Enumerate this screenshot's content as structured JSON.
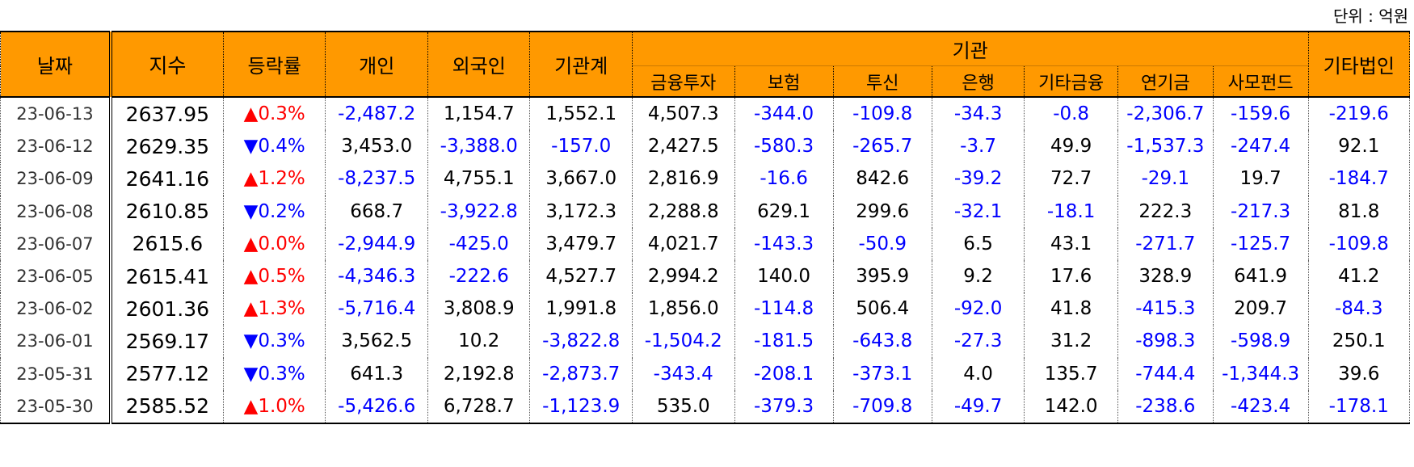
{
  "unit_label": "단위 : 억원",
  "headers": {
    "date": "날짜",
    "index": "지수",
    "change": "등락률",
    "individual": "개인",
    "foreign": "외국인",
    "inst_total": "기관계",
    "institution": "기관",
    "sub": [
      "금융투자",
      "보험",
      "투신",
      "은행",
      "기타금융",
      "연기금",
      "사모펀드"
    ],
    "other_corp": "기타법인"
  },
  "up_glyph": "▲",
  "down_glyph": "▼",
  "rows": [
    {
      "date": "23-06-13",
      "index": "2637.95",
      "dir": "up",
      "rate": "0.3%",
      "vals": [
        "-2,487.2",
        "1,154.7",
        "1,552.1",
        "4,507.3",
        "-344.0",
        "-109.8",
        "-34.3",
        "-0.8",
        "-2,306.7",
        "-159.6",
        "-219.6"
      ]
    },
    {
      "date": "23-06-12",
      "index": "2629.35",
      "dir": "down",
      "rate": "0.4%",
      "vals": [
        "3,453.0",
        "-3,388.0",
        "-157.0",
        "2,427.5",
        "-580.3",
        "-265.7",
        "-3.7",
        "49.9",
        "-1,537.3",
        "-247.4",
        "92.1"
      ]
    },
    {
      "date": "23-06-09",
      "index": "2641.16",
      "dir": "up",
      "rate": "1.2%",
      "vals": [
        "-8,237.5",
        "4,755.1",
        "3,667.0",
        "2,816.9",
        "-16.6",
        "842.6",
        "-39.2",
        "72.7",
        "-29.1",
        "19.7",
        "-184.7"
      ]
    },
    {
      "date": "23-06-08",
      "index": "2610.85",
      "dir": "down",
      "rate": "0.2%",
      "vals": [
        "668.7",
        "-3,922.8",
        "3,172.3",
        "2,288.8",
        "629.1",
        "299.6",
        "-32.1",
        "-18.1",
        "222.3",
        "-217.3",
        "81.8"
      ]
    },
    {
      "date": "23-06-07",
      "index": "2615.6",
      "dir": "up",
      "rate": "0.0%",
      "vals": [
        "-2,944.9",
        "-425.0",
        "3,479.7",
        "4,021.7",
        "-143.3",
        "-50.9",
        "6.5",
        "43.1",
        "-271.7",
        "-125.7",
        "-109.8"
      ]
    },
    {
      "date": "23-06-05",
      "index": "2615.41",
      "dir": "up",
      "rate": "0.5%",
      "vals": [
        "-4,346.3",
        "-222.6",
        "4,527.7",
        "2,994.2",
        "140.0",
        "395.9",
        "9.2",
        "17.6",
        "328.9",
        "641.9",
        "41.2"
      ]
    },
    {
      "date": "23-06-02",
      "index": "2601.36",
      "dir": "up",
      "rate": "1.3%",
      "vals": [
        "-5,716.4",
        "3,808.9",
        "1,991.8",
        "1,856.0",
        "-114.8",
        "506.4",
        "-92.0",
        "41.8",
        "-415.3",
        "209.7",
        "-84.3"
      ]
    },
    {
      "date": "23-06-01",
      "index": "2569.17",
      "dir": "down",
      "rate": "0.3%",
      "vals": [
        "3,562.5",
        "10.2",
        "-3,822.8",
        "-1,504.2",
        "-181.5",
        "-643.8",
        "-27.3",
        "31.2",
        "-898.3",
        "-598.9",
        "250.1"
      ]
    },
    {
      "date": "23-05-31",
      "index": "2577.12",
      "dir": "down",
      "rate": "0.3%",
      "vals": [
        "641.3",
        "2,192.8",
        "-2,873.7",
        "-343.4",
        "-208.1",
        "-373.1",
        "4.0",
        "135.7",
        "-744.4",
        "-1,344.3",
        "39.6"
      ]
    },
    {
      "date": "23-05-30",
      "index": "2585.52",
      "dir": "up",
      "rate": "1.0%",
      "vals": [
        "-5,426.6",
        "6,728.7",
        "-1,123.9",
        "535.0",
        "-379.3",
        "-709.8",
        "-49.7",
        "142.0",
        "-238.6",
        "-423.4",
        "-178.1"
      ]
    }
  ],
  "colors": {
    "header_bg": "#ff9900",
    "negative": "#0000ff",
    "up": "#ff0000",
    "down": "#0000ff"
  }
}
